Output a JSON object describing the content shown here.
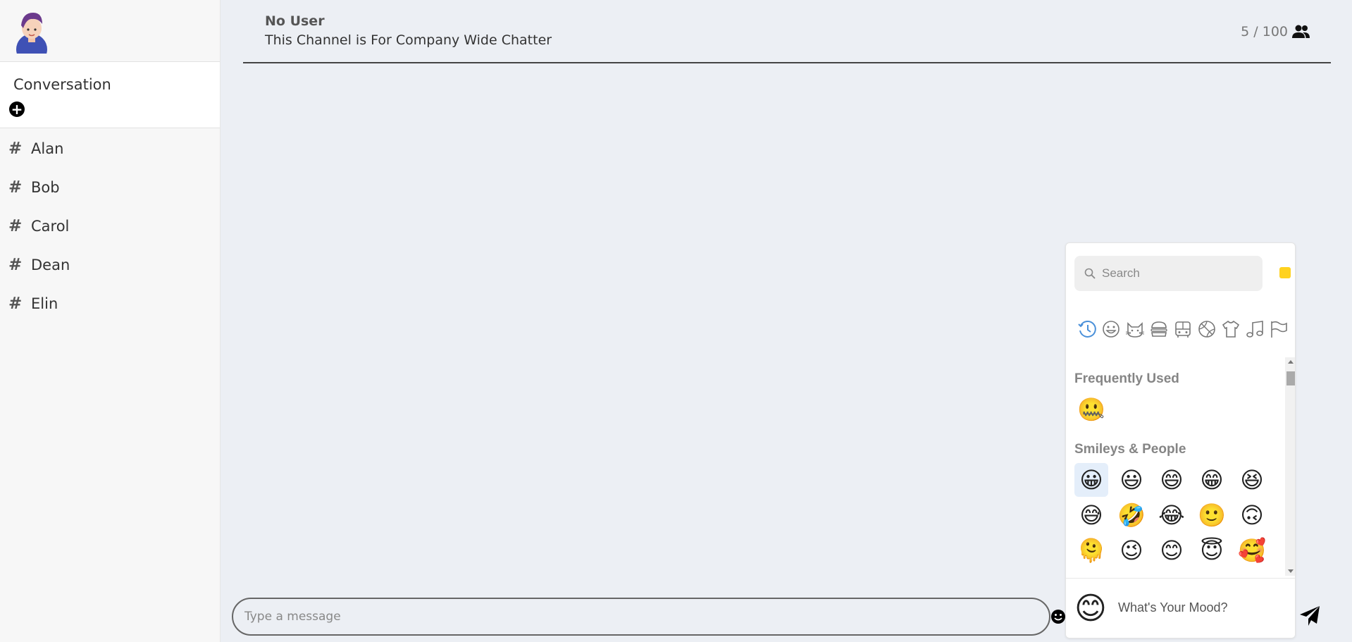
{
  "sidebar": {
    "conversation_title": "Conversation",
    "add_label": "+",
    "channels": [
      {
        "hash": "#",
        "name": "Alan"
      },
      {
        "hash": "#",
        "name": "Bob"
      },
      {
        "hash": "#",
        "name": "Carol"
      },
      {
        "hash": "#",
        "name": "Dean"
      },
      {
        "hash": "#",
        "name": "Elin"
      }
    ]
  },
  "header": {
    "user": "No User",
    "description": "This Channel is For Company Wide Chatter",
    "member_count": "5 / 100",
    "members_icon": "users-icon"
  },
  "composer": {
    "placeholder": "Type a message",
    "emoji_icon": "smiley-icon",
    "send_icon": "send-icon"
  },
  "emoji_picker": {
    "search_placeholder": "Search",
    "skin_tone_color": "#ffd21f",
    "categories": [
      "recent-icon",
      "smileys-icon",
      "animals-icon",
      "food-icon",
      "travel-icon",
      "activities-icon",
      "objects-icon",
      "symbols-icon",
      "flags-icon"
    ],
    "active_category_color": "#4a90d9",
    "frequently_used_title": "Frequently Used",
    "frequently_used": [
      "🤐"
    ],
    "smileys_title": "Smileys & People",
    "smileys": [
      "😀",
      "😃",
      "😄",
      "😁",
      "😆",
      "😅",
      "🤣",
      "😂",
      "🙂",
      "🙃",
      "🫠",
      "😉",
      "😊",
      "😇",
      "🥰"
    ],
    "mood_emoji": "😊",
    "mood_placeholder": "What's Your Mood?"
  }
}
